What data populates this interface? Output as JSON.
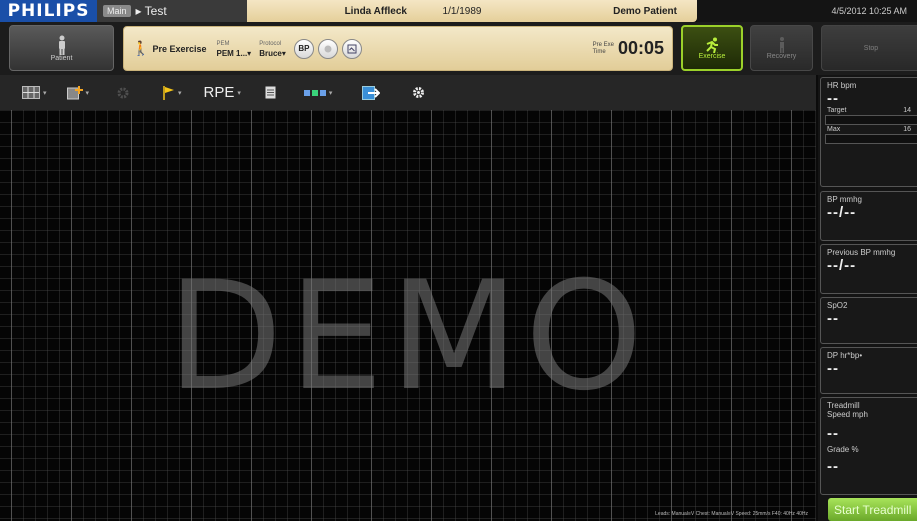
{
  "header": {
    "logo": "PHILIPS",
    "mode_badge": "Main",
    "mode_label": "▸ Test",
    "patient_name": "Linda Affleck",
    "patient_dob": "1/1/1989",
    "patient_type": "Demo Patient",
    "datetime": "4/5/2012 10:25 AM"
  },
  "row2": {
    "patient_button_label": "Patient",
    "stage_label": "Pre Exercise",
    "pem": {
      "caption": "PEM",
      "value": "PEM 1...▾"
    },
    "protocol": {
      "caption": "Protocol",
      "value": "Bruce▾"
    },
    "bp_label": "BP",
    "timer_caption_line1": "Pre Exe",
    "timer_caption_line2": "Time",
    "timer_value": "00:05",
    "exercise_label": "Exercise",
    "recovery_label": "Recovery",
    "right_label": "Stop"
  },
  "toolbar": {
    "rpe_label": "RPE"
  },
  "waveform": {
    "watermark": "DEMO",
    "footnote": "Leads: Manual≡V  Chest: Manual≡V  Speed: 25mm/s  F40: 40Hz  40Hz"
  },
  "vitals": {
    "hr": {
      "title": "HR bpm",
      "value": "--",
      "target_label": "Target",
      "target_value": "14",
      "max_label": "Max",
      "max_value": "16"
    },
    "bp": {
      "title": "BP mmhg",
      "value": "--/--"
    },
    "prev_bp": {
      "title": "Previous BP mmhg",
      "value": "--/--"
    },
    "spo2": {
      "title": "SpO2",
      "value": "--"
    },
    "dp": {
      "title": "DP hr*bp•",
      "value": "--"
    },
    "treadmill": {
      "title_line1": "Treadmill",
      "title_line2": "Speed mph",
      "speed_value": "--",
      "grade_title": "Grade %",
      "grade_value": "--"
    },
    "start_treadmill": "Start Treadmill"
  },
  "colors": {
    "logo_bg": "#1a4fa8",
    "patient_strip": "#eedcae",
    "exercise_accent": "#9bd12a"
  }
}
